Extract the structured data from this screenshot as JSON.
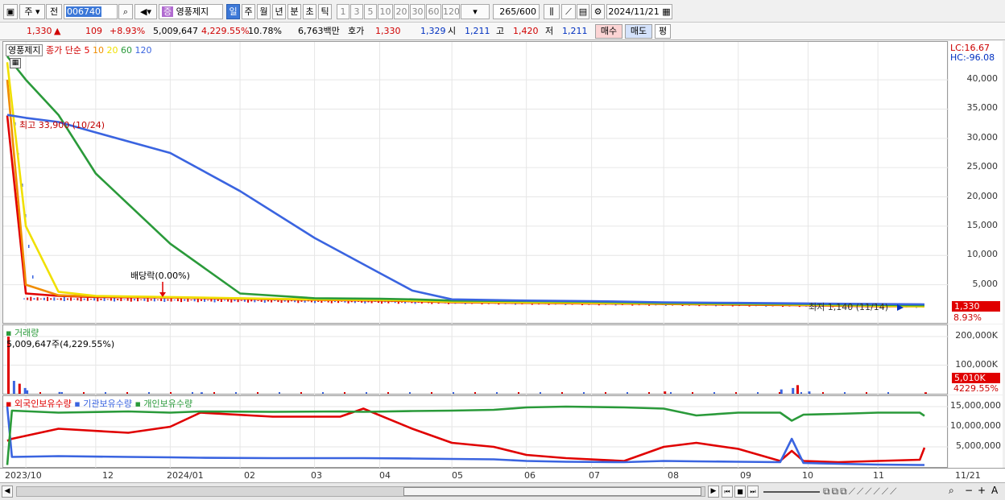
{
  "toolbar": {
    "mode_label": "주",
    "prev_label": "전",
    "code": "006740",
    "stock_name": "영풍제지",
    "stock_badge": "증",
    "periods": [
      "일",
      "주",
      "월",
      "년",
      "분",
      "초",
      "틱"
    ],
    "intervals": [
      "1",
      "3",
      "5",
      "10",
      "20",
      "30",
      "60",
      "120"
    ],
    "count_value": "265",
    "count_total": "/600",
    "date": "2024/11/21"
  },
  "quote": {
    "price": "1,330",
    "change_arrow": "▲",
    "change": "109",
    "change_pct": "+8.93%",
    "volume": "5,009,647",
    "volume_pct": "4,229.55%",
    "turnover_pct": "10.78%",
    "amount": "6,763백만",
    "hoga_label": "호가",
    "ask": "1,330",
    "bid": "1,329",
    "open_label": "시",
    "open": "1,211",
    "high_label": "고",
    "high": "1,420",
    "low_label": "저",
    "low": "1,211",
    "buy_label": "매수",
    "sell_label": "매도",
    "eval_label": "평"
  },
  "price_panel": {
    "stock_label": "영풍제지",
    "ma_label": "종가 단순",
    "ma_periods": [
      "5",
      "10",
      "20",
      "60",
      "120"
    ],
    "ma_colors": [
      "#e00000",
      "#f08c00",
      "#f0e000",
      "#2a9a3a",
      "#3a64e0"
    ],
    "lc": "LC:16.67",
    "hc": "HC:-96.08",
    "y_ticks": [
      "40,000",
      "35,000",
      "30,000",
      "25,000",
      "20,000",
      "15,000",
      "10,000",
      "5,000"
    ],
    "max_annotation": "최고 33,900 (10/24)",
    "min_annotation": "최저 1,140 (11/14)",
    "dividend_annotation": "배당락(0.00%)",
    "price_tag": "1,330",
    "pct_tag": "8.93%"
  },
  "volume_panel": {
    "title": "거래량",
    "summary": "5,009,647주(4,229.55%)",
    "y_ticks": [
      "200,000K",
      "100,000K"
    ],
    "vol_tag": "5,010K",
    "pct_tag": "4229.55%"
  },
  "holding_panel": {
    "titles": [
      "외국인보유수량",
      "기관보유수량",
      "개인보유수량"
    ],
    "colors": [
      "#e00000",
      "#3a64e0",
      "#2a9a3a"
    ],
    "y_ticks": [
      "15,000,000",
      "10,000,000",
      "5,000,000"
    ]
  },
  "x_axis": {
    "labels": [
      "2023/10",
      "12",
      "2024/01",
      "02",
      "03",
      "04",
      "05",
      "06",
      "07",
      "08",
      "09",
      "10",
      "11",
      "11/21"
    ]
  },
  "chart_data": [
    {
      "type": "line",
      "title": "",
      "ylabel": "",
      "ylim": [
        0,
        44000
      ],
      "x": [
        "2023/10/24",
        "2023/11/01",
        "2023/11/15",
        "2023/12/01",
        "2024/01/02",
        "2024/02/01",
        "2024/03/04",
        "2024/04/01",
        "2024/04/15",
        "2024/05/02",
        "2024/06/03",
        "2024/07/01",
        "2024/08/01",
        "2024/09/02",
        "2024/10/02",
        "2024/11/01",
        "2024/11/21"
      ],
      "series": [
        {
          "name": "5",
          "values": [
            33900,
            3500,
            3100,
            2900,
            2800,
            2600,
            2400,
            2300,
            2200,
            2000,
            1900,
            1800,
            1700,
            1600,
            1500,
            1300,
            1330
          ]
        },
        {
          "name": "10",
          "values": [
            40000,
            5000,
            3200,
            3000,
            2850,
            2650,
            2450,
            2350,
            2250,
            2050,
            1950,
            1850,
            1750,
            1650,
            1550,
            1350,
            1300
          ]
        },
        {
          "name": "20",
          "values": [
            43000,
            15000,
            3800,
            3100,
            2900,
            2700,
            2500,
            2400,
            2300,
            2100,
            2000,
            1900,
            1800,
            1700,
            1600,
            1400,
            1300
          ]
        },
        {
          "name": "60",
          "values": [
            44000,
            40000,
            34000,
            24000,
            12000,
            3500,
            2700,
            2600,
            2500,
            2300,
            2200,
            2100,
            1900,
            1800,
            1700,
            1550,
            1500
          ]
        },
        {
          "name": "120",
          "values": [
            34000,
            33500,
            32800,
            31000,
            27500,
            21000,
            13000,
            7000,
            4000,
            2500,
            2300,
            2200,
            2000,
            1900,
            1800,
            1700,
            1650
          ]
        }
      ]
    },
    {
      "type": "bar",
      "title": "거래량",
      "ylim": [
        0,
        200000
      ],
      "unit": "K",
      "categories": [
        "2023/10/24",
        "2023/10/25",
        "2023/10/26",
        "2023/10/27",
        "2023/11/01",
        "2023/11/15",
        "2024/01/15",
        "2024/08/01",
        "2024/09/20",
        "2024/09/25",
        "2024/09/27",
        "2024/10/02",
        "2024/11/21"
      ],
      "values": [
        200000,
        45000,
        35000,
        20000,
        12000,
        6000,
        5000,
        8000,
        15000,
        20000,
        30000,
        8000,
        5010
      ]
    },
    {
      "type": "line",
      "title": "",
      "ylim": [
        0,
        16000000
      ],
      "x": [
        "2023/10/24",
        "2023/10/26",
        "2023/11/15",
        "2023/12/15",
        "2024/01/02",
        "2024/01/15",
        "2024/02/15",
        "2024/03/15",
        "2024/03/25",
        "2024/04/15",
        "2024/05/02",
        "2024/05/20",
        "2024/06/03",
        "2024/06/20",
        "2024/07/15",
        "2024/08/01",
        "2024/08/15",
        "2024/09/02",
        "2024/09/20",
        "2024/09/25",
        "2024/09/30",
        "2024/10/15",
        "2024/11/01",
        "2024/11/19",
        "2024/11/21"
      ],
      "series": [
        {
          "name": "외국인보유수량",
          "values": [
            6500000,
            7000000,
            9500000,
            8500000,
            10000000,
            13500000,
            12500000,
            12500000,
            14500000,
            9500000,
            6000000,
            5000000,
            3000000,
            2200000,
            1500000,
            5000000,
            6000000,
            4500000,
            1500000,
            4000000,
            1500000,
            1200000,
            1500000,
            1800000,
            4800000
          ]
        },
        {
          "name": "기관보유수량",
          "values": [
            15000000,
            2500000,
            2700000,
            2500000,
            2400000,
            2300000,
            2200000,
            2200000,
            2200000,
            2100000,
            2000000,
            1900000,
            1500000,
            1300000,
            1200000,
            1500000,
            1400000,
            1300000,
            1200000,
            7000000,
            1000000,
            800000,
            600000,
            500000,
            500000
          ]
        },
        {
          "name": "개인보유수량",
          "values": [
            500000,
            14000000,
            13500000,
            13800000,
            13500000,
            13800000,
            13700000,
            13800000,
            13700000,
            13900000,
            14000000,
            14200000,
            14800000,
            15000000,
            14800000,
            14500000,
            12800000,
            13500000,
            13500000,
            11500000,
            13000000,
            13200000,
            13500000,
            13500000,
            12700000
          ]
        }
      ]
    }
  ]
}
